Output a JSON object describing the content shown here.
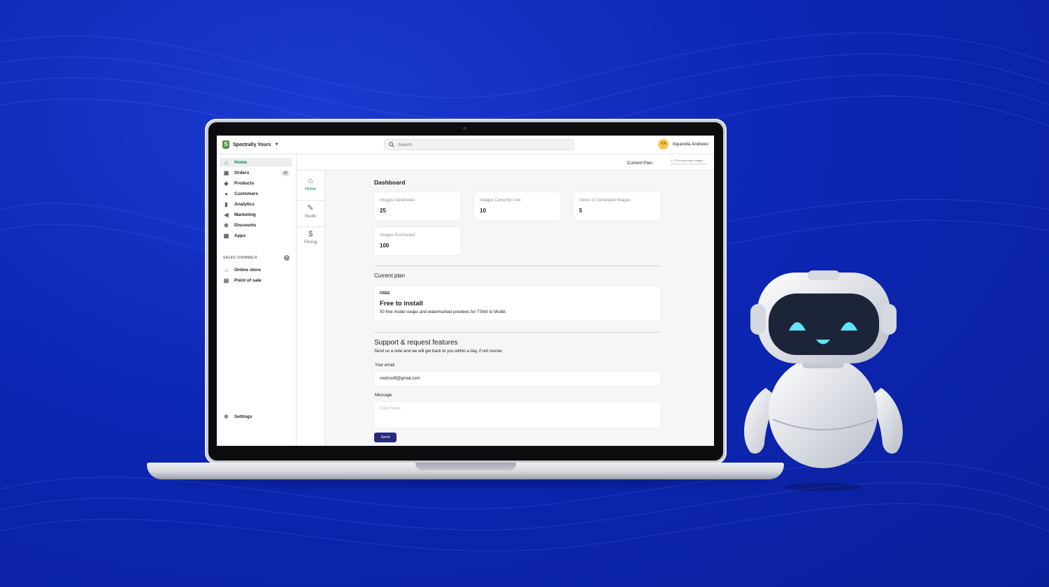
{
  "topbar": {
    "store_name": "Spectrally Yours",
    "search_placeholder": "Search",
    "user_initials": "XA",
    "user_name": "Xquenda Andreev"
  },
  "sidebar": {
    "items": [
      {
        "label": "Home",
        "icon": "home-icon",
        "active": true
      },
      {
        "label": "Orders",
        "icon": "orders-icon",
        "badge": "15"
      },
      {
        "label": "Products",
        "icon": "tag-icon"
      },
      {
        "label": "Customers",
        "icon": "person-icon"
      },
      {
        "label": "Analytics",
        "icon": "bar-chart-icon"
      },
      {
        "label": "Marketing",
        "icon": "megaphone-icon"
      },
      {
        "label": "Discounts",
        "icon": "discount-icon"
      },
      {
        "label": "Apps",
        "icon": "apps-icon"
      }
    ],
    "sales_channels_heading": "SALES CHANNELS",
    "channels": [
      {
        "label": "Online store",
        "icon": "store-icon"
      },
      {
        "label": "Point of sale",
        "icon": "pos-icon"
      }
    ],
    "settings_label": "Settings"
  },
  "app_nav": {
    "items": [
      {
        "label": "Home",
        "icon": "home-icon",
        "active": true
      },
      {
        "label": "Studio",
        "icon": "edit-icon"
      },
      {
        "label": "Pricing",
        "icon": "dollar-icon"
      }
    ]
  },
  "plan_header": {
    "label": "Current Plan",
    "usage_text": "0 / 25 model swap images",
    "usage_fraction": 0
  },
  "dashboard": {
    "title": "Dashboard",
    "stats": [
      {
        "label": "Images Generated",
        "value": "25"
      },
      {
        "label": "Images Currently Live",
        "value": "10"
      },
      {
        "label": "Views of Generated Images",
        "value": "5"
      },
      {
        "label": "Images Purchased",
        "value": "100"
      }
    ]
  },
  "current_plan": {
    "heading": "Current plan",
    "tier": "FREE",
    "title": "Free to install",
    "description": "50 free model swaps and watermarked previews for TShirt to Model."
  },
  "support": {
    "heading": "Support & request features",
    "note": "Send us a note and we will get back to you within a day, if not sooner.",
    "email_label": "Your email",
    "email_value": "metizsoft@gmail.com",
    "message_label": "Message",
    "message_placeholder": "Enter here...",
    "send_label": "Send"
  },
  "colors": {
    "background": "#0d27b5",
    "accent_green": "#007f5f",
    "send_button": "#262a7a",
    "avatar": "#ffc453"
  }
}
